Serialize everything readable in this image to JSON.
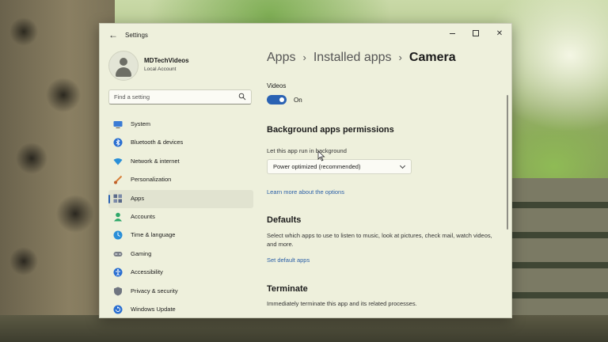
{
  "window": {
    "app_title": "Settings",
    "back_glyph": "←",
    "close_glyph": "✕"
  },
  "profile": {
    "name": "MDTechVideos",
    "account_type": "Local Account"
  },
  "search": {
    "placeholder": "Find a setting"
  },
  "sidebar": {
    "items": [
      {
        "label": "System",
        "icon": "monitor-icon",
        "color": "#3a7bd5"
      },
      {
        "label": "Bluetooth & devices",
        "icon": "bluetooth-icon",
        "color": "#2a6fd1"
      },
      {
        "label": "Network & internet",
        "icon": "wifi-icon",
        "color": "#2a8fd8"
      },
      {
        "label": "Personalization",
        "icon": "brush-icon",
        "color": "#d8803a"
      },
      {
        "label": "Apps",
        "icon": "apps-icon",
        "color": "#5a6a8a",
        "active": true
      },
      {
        "label": "Accounts",
        "icon": "person-icon",
        "color": "#2fa86a"
      },
      {
        "label": "Time & language",
        "icon": "globe-clock-icon",
        "color": "#2a8fd8"
      },
      {
        "label": "Gaming",
        "icon": "controller-icon",
        "color": "#7a7f88"
      },
      {
        "label": "Accessibility",
        "icon": "accessibility-icon",
        "color": "#2a6fd1"
      },
      {
        "label": "Privacy & security",
        "icon": "shield-icon",
        "color": "#6f7580"
      },
      {
        "label": "Windows Update",
        "icon": "update-icon",
        "color": "#2a6fd1"
      }
    ]
  },
  "breadcrumb": {
    "items": [
      "Apps",
      "Installed apps"
    ],
    "separator": "›",
    "current": "Camera"
  },
  "content": {
    "videos_label": "Videos",
    "videos_toggle_state": "On",
    "background_title": "Background apps permissions",
    "background_label": "Let this app run in background",
    "background_dropdown_value": "Power optimized (recommended)",
    "learn_more_link": "Learn more about the options",
    "defaults_title": "Defaults",
    "defaults_text": "Select which apps to use to listen to music, look at pictures, check mail, watch videos, and more.",
    "defaults_link": "Set default apps",
    "terminate_title": "Terminate",
    "terminate_text": "Immediately terminate this app and its related processes."
  },
  "colors": {
    "accent": "#2a62b3",
    "link": "#2a5fa7"
  }
}
